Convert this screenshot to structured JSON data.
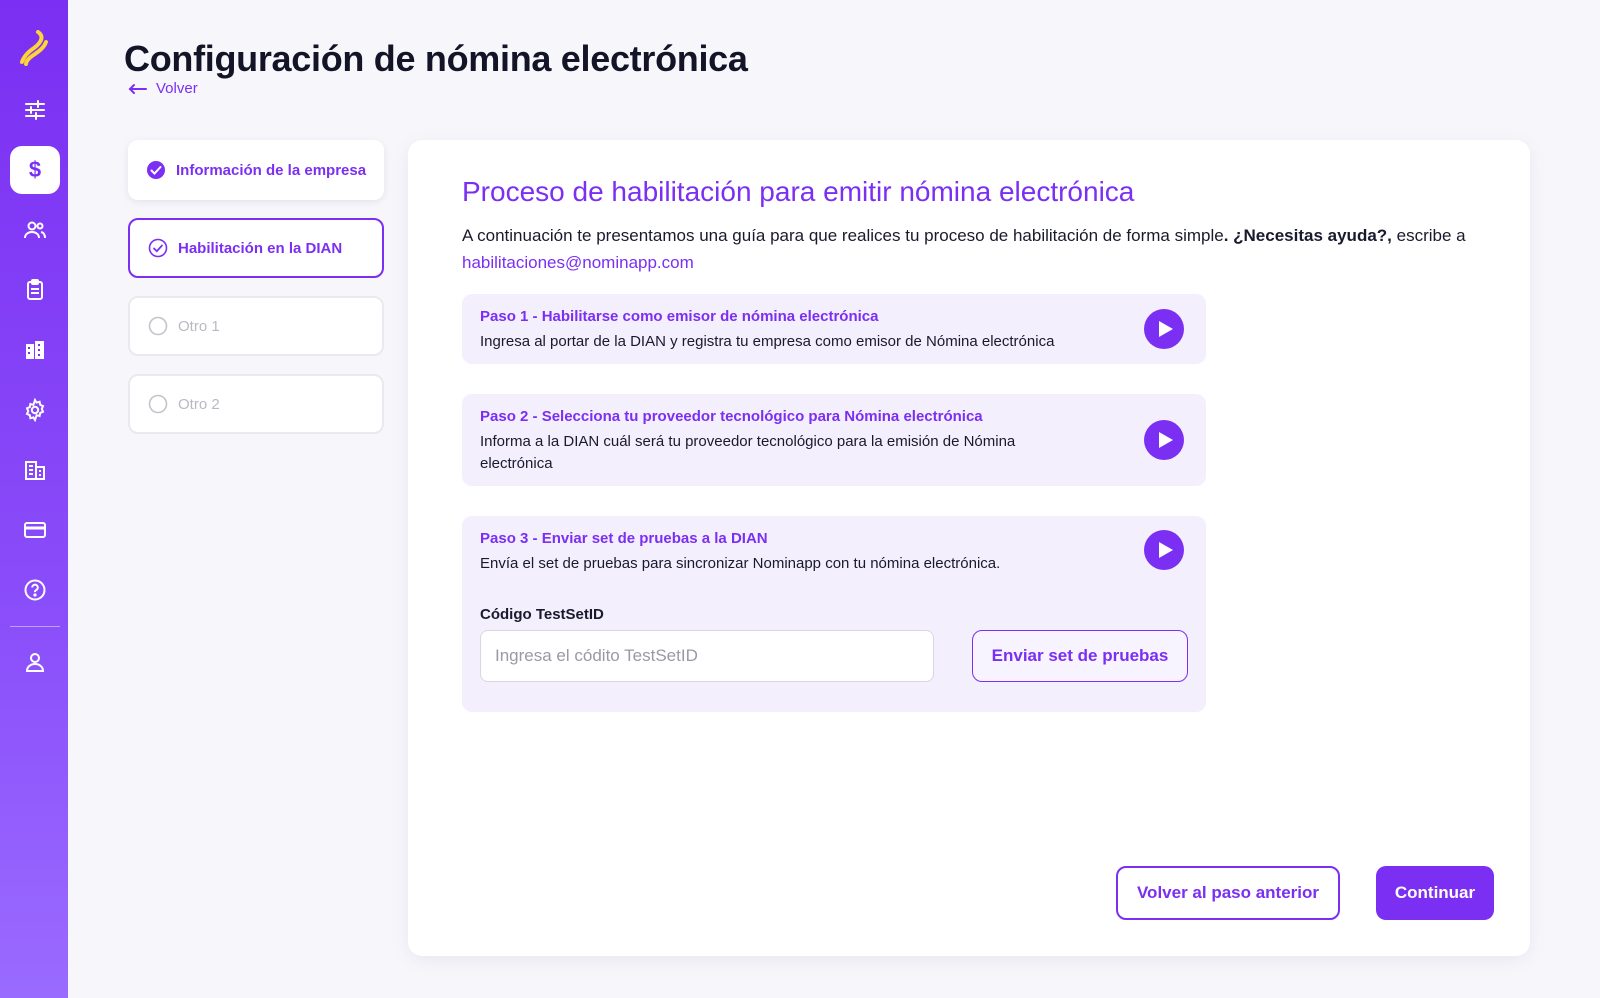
{
  "app": {
    "title": "Configuración de nómina electrónica",
    "back_label": "Volver",
    "accent": "#7b2ff2"
  },
  "sidebar": {
    "items": [
      {
        "icon": "sliders-icon"
      },
      {
        "icon": "dollar-icon",
        "active": true
      },
      {
        "icon": "users-icon"
      },
      {
        "icon": "clipboard-icon"
      },
      {
        "icon": "building-icon"
      },
      {
        "icon": "gear-icon"
      },
      {
        "icon": "office-icon"
      },
      {
        "icon": "credit-card-icon"
      },
      {
        "icon": "help-icon"
      },
      {
        "icon": "user-icon"
      }
    ]
  },
  "steps": [
    {
      "label": "Información de la empresa",
      "status": "done"
    },
    {
      "label": "Habilitación en la DIAN",
      "status": "current"
    },
    {
      "label": "Otro 1",
      "status": "pending"
    },
    {
      "label": "Otro 2",
      "status": "pending"
    }
  ],
  "main": {
    "title": "Proceso de habilitación para emitir nómina electrónica",
    "desc_text": "A continuación te presentamos una guía para que realices tu proceso de habilitación de forma simple",
    "desc_help": ". ¿Necesitas ayuda?,",
    "desc_write": " escribe a ",
    "desc_email": "habilitaciones@nominapp.com",
    "process_steps": [
      {
        "title": "Paso 1 - Habilitarse como emisor de nómina electrónica",
        "desc": "Ingresa al portar de la DIAN y registra tu empresa como emisor de Nómina electrónica"
      },
      {
        "title": "Paso 2 - Selecciona tu proveedor tecnológico para Nómina electrónica",
        "desc": "Informa a la DIAN cuál será tu proveedor tecnológico para la emisión de Nómina electrónica"
      },
      {
        "title": "Paso 3 - Enviar set de pruebas a la DIAN",
        "desc": "Envía el set de pruebas para sincronizar Nominapp con tu nómina electrónica."
      }
    ],
    "code_label": "Código TestSetID",
    "code_value": "",
    "code_placeholder": "Ingresa el códito TestSetID",
    "send_label": "Enviar set de pruebas",
    "prev_label": "Volver al paso anterior",
    "next_label": "Continuar"
  }
}
